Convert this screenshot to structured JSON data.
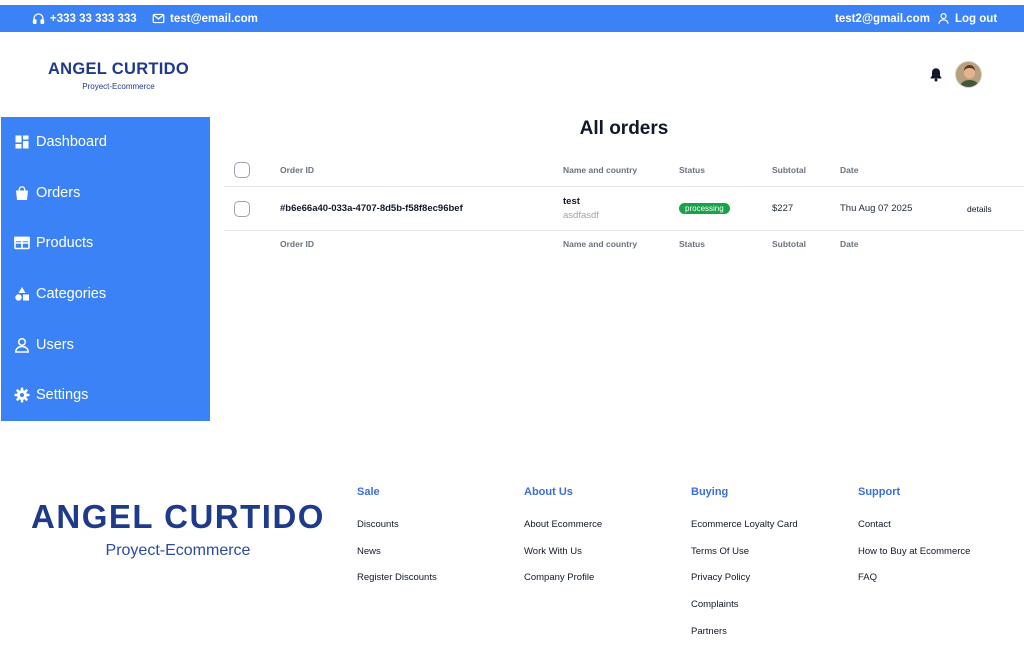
{
  "topbar": {
    "phone": "+333 33 333 333",
    "email": "test@email.com",
    "user_email": "test2@gmail.com",
    "logout": "Log out"
  },
  "header": {
    "brand": "ANGEL CURTIDO",
    "brand_sub": "Proyect-Ecommerce"
  },
  "sidebar": {
    "items": [
      {
        "label": "Dashboard",
        "icon": "dashboard-icon"
      },
      {
        "label": "Orders",
        "icon": "bag-icon"
      },
      {
        "label": "Products",
        "icon": "table-icon"
      },
      {
        "label": "Categories",
        "icon": "shapes-icon"
      },
      {
        "label": "Users",
        "icon": "user-icon"
      },
      {
        "label": "Settings",
        "icon": "gear-icon"
      }
    ]
  },
  "main": {
    "title": "All orders",
    "columns": {
      "order_id": "Order ID",
      "name_country": "Name and country",
      "status": "Status",
      "subtotal": "Subtotal",
      "date": "Date"
    },
    "orders": [
      {
        "id": "#b6e66a40-033a-4707-8d5b-f58f8ec96bef",
        "name": "test",
        "country": "asdfasdf",
        "status": "processing",
        "subtotal": "$227",
        "date": "Thu Aug 07 2025",
        "action": "details"
      }
    ],
    "status_color": "#16a34a"
  },
  "footer": {
    "brand": "ANGEL CURTIDO",
    "brand_sub": "Proyect-Ecommerce",
    "columns": [
      {
        "title": "Sale",
        "links": [
          "Discounts",
          "News",
          "Register Discounts"
        ]
      },
      {
        "title": "About Us",
        "links": [
          "About Ecommerce",
          "Work With Us",
          "Company Profile"
        ]
      },
      {
        "title": "Buying",
        "links": [
          "Ecommerce Loyalty Card",
          "Terms Of Use",
          "Privacy Policy",
          "Complaints",
          "Partners"
        ]
      },
      {
        "title": "Support",
        "links": [
          "Contact",
          "How to Buy at Ecommerce",
          "FAQ"
        ]
      }
    ]
  },
  "colors": {
    "accent": "#3b82f6",
    "brand": "#1e3a8a",
    "footer_heading": "#3b6fd8"
  }
}
